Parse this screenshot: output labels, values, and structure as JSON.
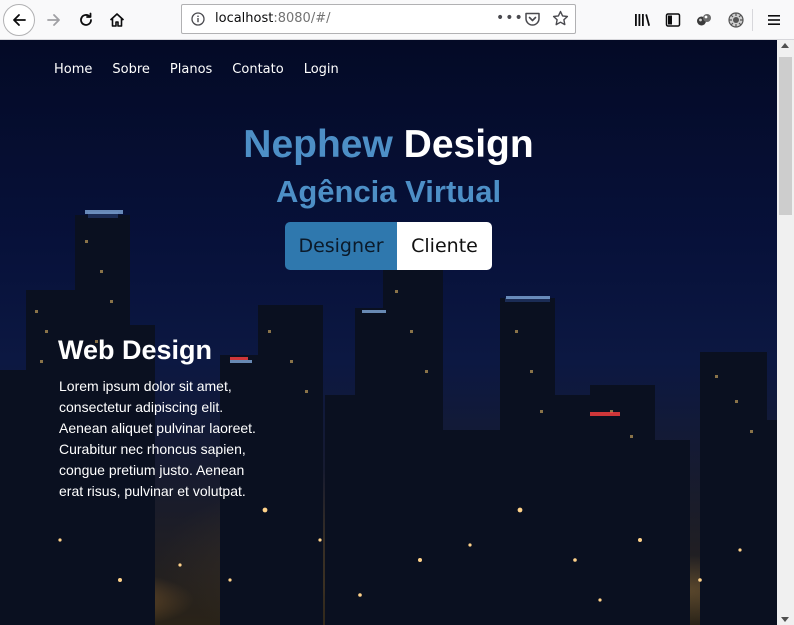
{
  "browser": {
    "url_host": "localhost",
    "url_rest": ":8080/#/",
    "more_label": "•••"
  },
  "site": {
    "nav": [
      {
        "label": "Home"
      },
      {
        "label": "Sobre"
      },
      {
        "label": "Planos"
      },
      {
        "label": "Contato"
      },
      {
        "label": "Login"
      }
    ],
    "title_part1": "Nephew",
    "title_part2": "Design",
    "subtitle": "Agência Virtual",
    "buttons": {
      "designer": "Designer",
      "cliente": "Cliente"
    },
    "section": {
      "title": "Web Design",
      "text": "Lorem ipsum dolor sit amet, consectetur adipiscing elit. Aenean aliquet pulvinar laoreet. Curabitur nec rhoncus sapien, congue pretium justo. Aenean erat risus, pulvinar et volutpat."
    }
  },
  "colors": {
    "accent_blue": "#4d8fc6",
    "button_blue": "#2f78ae",
    "night_sky": "#07113a"
  }
}
